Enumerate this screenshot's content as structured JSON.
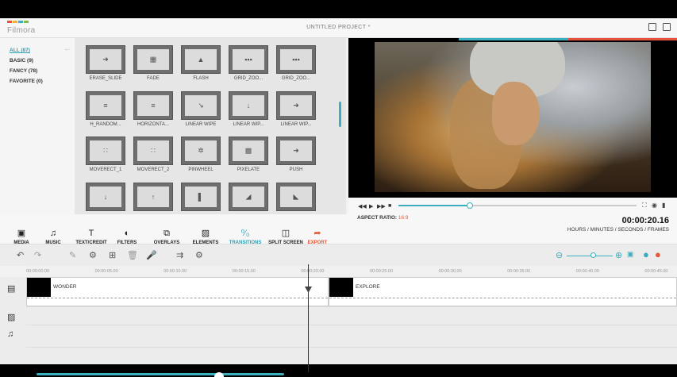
{
  "app": {
    "logo_text": "Filmora",
    "logo_colors": [
      "#e5533c",
      "#f2b233",
      "#3aaebf",
      "#7dbb42"
    ],
    "project_title": "UNTITLED PROJECT *"
  },
  "categories": [
    {
      "label": "ALL (87)",
      "active": true
    },
    {
      "label": "BASIC (9)",
      "active": false
    },
    {
      "label": "FANCY (78)",
      "active": false
    },
    {
      "label": "FAVORITE (0)",
      "active": false
    }
  ],
  "transitions": [
    {
      "label": "ERASE_SLIDE",
      "mark": "➜"
    },
    {
      "label": "FADE",
      "mark": "▦"
    },
    {
      "label": "FLASH",
      "mark": "▲"
    },
    {
      "label": "GRID_ZOO...",
      "mark": "▪▪▪"
    },
    {
      "label": "GRID_ZOO...",
      "mark": "▪▪▪"
    },
    {
      "label": "H_RANDOM...",
      "mark": "≡"
    },
    {
      "label": "HORIZONTA...",
      "mark": "≡"
    },
    {
      "label": "LINEAR WIPE",
      "mark": "↘"
    },
    {
      "label": "LINEAR WIP...",
      "mark": "↓"
    },
    {
      "label": "LINEAR WIP...",
      "mark": "➜"
    },
    {
      "label": "MOVERECT_1",
      "mark": "∷"
    },
    {
      "label": "MOVERECT_2",
      "mark": "∷"
    },
    {
      "label": "PINWHEEL",
      "mark": "✲"
    },
    {
      "label": "PIXELATE",
      "mark": "▩"
    },
    {
      "label": "PUSH",
      "mark": "➜"
    },
    {
      "label": "",
      "mark": "↓"
    },
    {
      "label": "",
      "mark": "↑"
    },
    {
      "label": "",
      "mark": "▌"
    },
    {
      "label": "",
      "mark": "◢"
    },
    {
      "label": "",
      "mark": "◣"
    }
  ],
  "toolbar": [
    {
      "label": "MEDIA",
      "icon": "film-icon",
      "glyph": "▣"
    },
    {
      "label": "MUSIC",
      "icon": "music-icon",
      "glyph": "♫"
    },
    {
      "label": "TEXT/CREDIT",
      "icon": "text-icon",
      "glyph": "T"
    },
    {
      "label": "FILTERS",
      "icon": "filter-icon",
      "glyph": "◐"
    },
    {
      "label": "OVERLAYS",
      "icon": "overlay-icon",
      "glyph": "⧉"
    },
    {
      "label": "ELEMENTS",
      "icon": "image-icon",
      "glyph": "▨"
    },
    {
      "label": "TRANSITIONS",
      "icon": "transitions-icon",
      "glyph": "⁰⁄₀"
    },
    {
      "label": "SPLIT SCREEN",
      "icon": "split-screen-icon",
      "glyph": "◫"
    },
    {
      "label": "EXPORT",
      "icon": "export-icon",
      "glyph": "➦"
    }
  ],
  "player": {
    "aspect_label": "ASPECT RATIO:",
    "aspect_value": "16:9",
    "timecode": "00:00:20.16",
    "time_format": "HOURS / MINUTES / SECONDS / FRAMES",
    "progress": 0.3
  },
  "ruler": [
    "00:00:00.00",
    "00:00:05.00",
    "00:00:10.00",
    "00:00:15.00",
    "00:00:20.00",
    "00:00:25.00",
    "00:00:30.00",
    "00:00:35.00",
    "00:00:40.00",
    "00:00:45.00"
  ],
  "clips": [
    {
      "name": "WONDER"
    },
    {
      "name": "EXPLORE"
    }
  ],
  "colors": {
    "accent": "#3aaebf",
    "export": "#e05a3a"
  }
}
